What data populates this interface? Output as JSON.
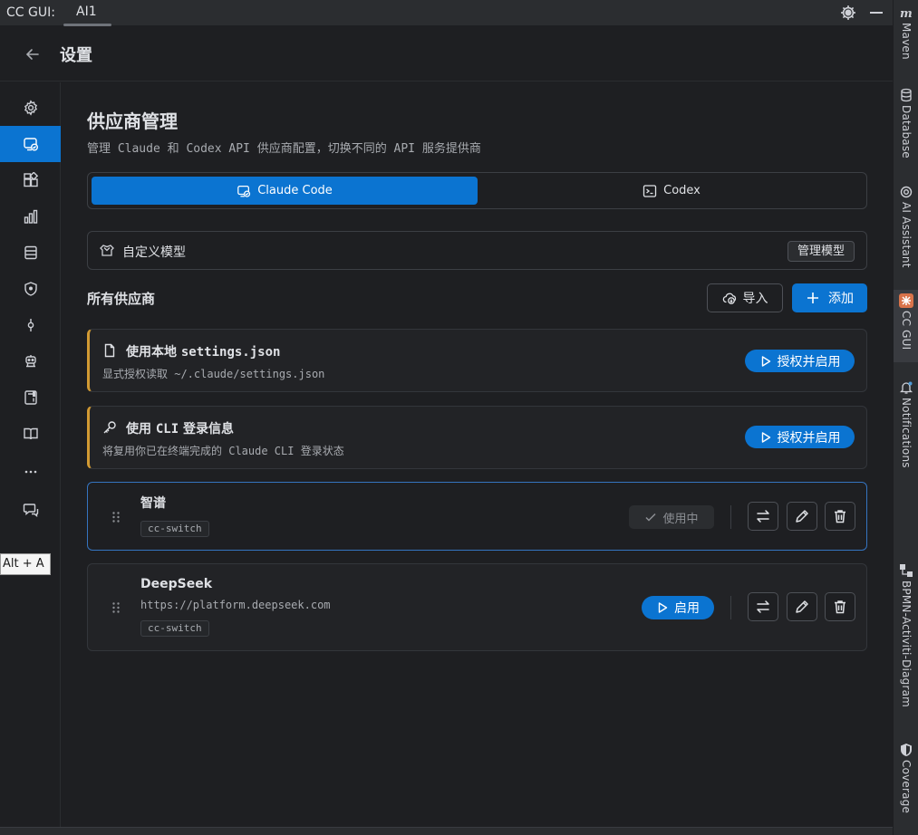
{
  "topbar": {
    "title": "CC GUI:",
    "tab": "AI1"
  },
  "right_strip": [
    {
      "label": "Maven",
      "icon": "maven-icon"
    },
    {
      "label": "Database",
      "icon": "database-icon"
    },
    {
      "label": "AI Assistant",
      "icon": "ai-assistant-icon"
    },
    {
      "label": "CC GUI",
      "icon": "cc-gui-icon",
      "active": true
    },
    {
      "label": "Notifications",
      "icon": "bell-icon"
    },
    {
      "label": "BPMN-Activiti-Diagram",
      "icon": "bpmn-icon"
    },
    {
      "label": "Coverage",
      "icon": "shield-icon"
    }
  ],
  "header": {
    "title": "设置"
  },
  "sidebar": {
    "items": [
      "settings-icon",
      "provider-icon",
      "plugins-icon",
      "usage-chart-icon",
      "database-icon",
      "permissions-shield-icon",
      "commit-icon",
      "agent-icon",
      "notebook-icon",
      "docs-book-icon",
      "more-icon",
      "feedback-icon"
    ]
  },
  "tooltip": "Alt + A",
  "main": {
    "title": "供应商管理",
    "subtitle": "管理 Claude 和 Codex API 供应商配置，切换不同的 API 服务提供商",
    "tabs": [
      {
        "label": "Claude Code",
        "active": true
      },
      {
        "label": "Codex",
        "active": false
      }
    ],
    "custom_model": {
      "label": "自定义模型",
      "button": "管理模型"
    },
    "providers_title": "所有供应商",
    "import_label": "导入",
    "add_label": "添加",
    "local_cards": [
      {
        "title_prefix": "使用本地 ",
        "title_mono": "settings.json",
        "desc": "显式授权读取 ~/.claude/settings.json",
        "button": "授权并启用"
      },
      {
        "title_prefix": "使用 ",
        "title_mono": "CLI",
        "title_suffix": " 登录信息",
        "desc": "将复用你已在终端完成的 Claude CLI 登录状态",
        "button": "授权并启用"
      }
    ],
    "providers": [
      {
        "name": "智谱",
        "tag": "cc-switch",
        "status": "使用中"
      },
      {
        "name": "DeepSeek",
        "url": "https://platform.deepseek.com",
        "tag": "cc-switch",
        "action": "启用"
      }
    ]
  },
  "colors": {
    "accent": "#0b74d1",
    "warn": "#d29a33",
    "active_border": "#3574c0"
  }
}
